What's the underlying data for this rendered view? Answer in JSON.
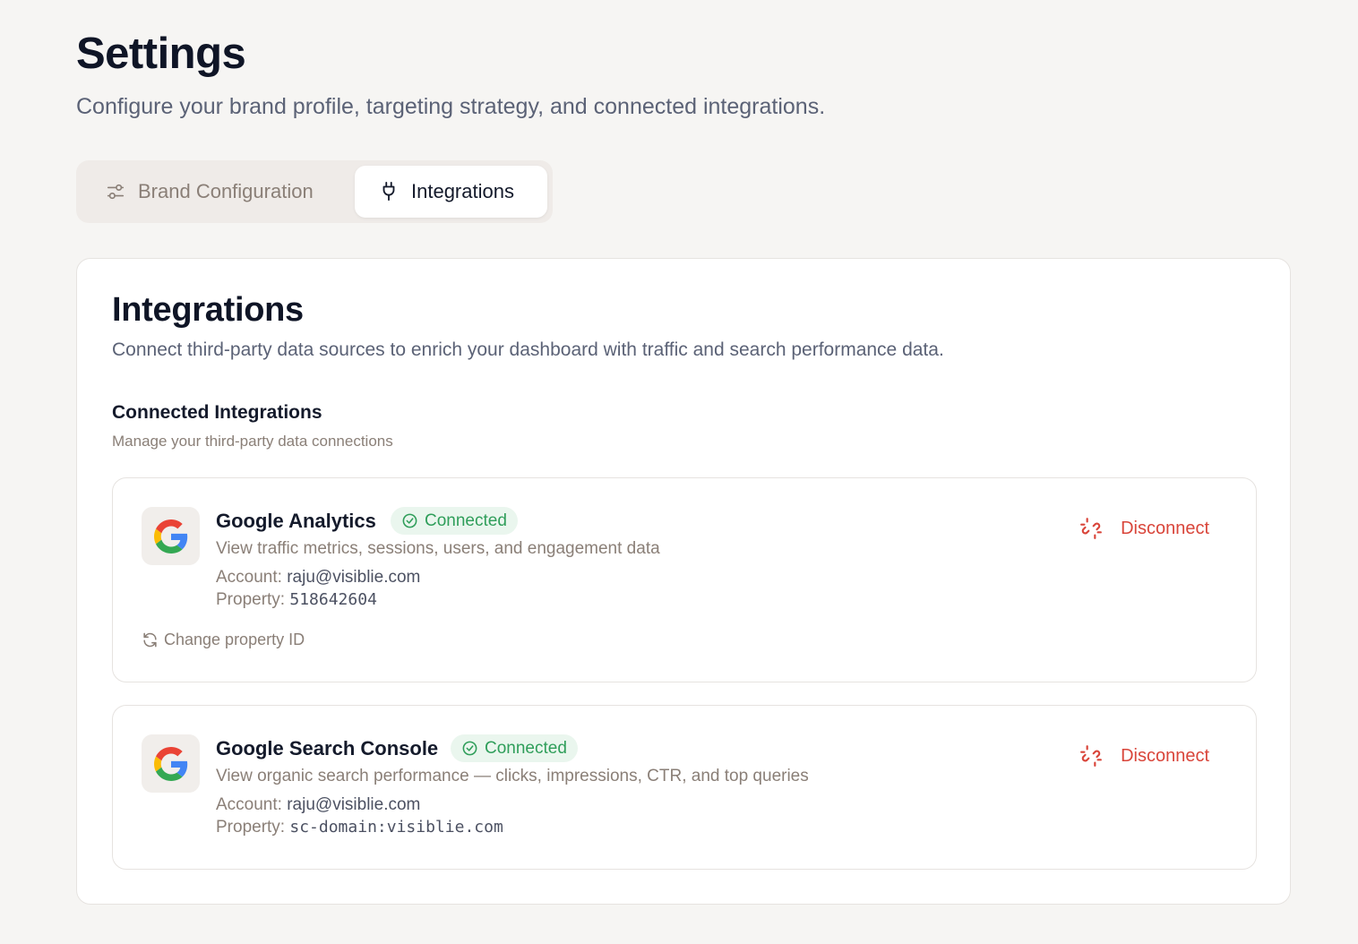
{
  "page": {
    "title": "Settings",
    "subtitle": "Configure your brand profile, targeting strategy, and connected integrations."
  },
  "tabs": [
    {
      "label": "Brand Configuration",
      "icon": "sliders-icon",
      "active": false
    },
    {
      "label": "Integrations",
      "icon": "plug-icon",
      "active": true
    }
  ],
  "integrations_panel": {
    "title": "Integrations",
    "description": "Connect third-party data sources to enrich your dashboard with traffic and search performance data.",
    "section_title": "Connected Integrations",
    "section_description": "Manage your third-party data connections",
    "items": [
      {
        "name": "Google Analytics",
        "status": "Connected",
        "description": "View traffic metrics, sessions, users, and engagement data",
        "account_label": "Account:",
        "account_value": "raju@visiblie.com",
        "property_label": "Property:",
        "property_value": "518642604",
        "disconnect_label": "Disconnect",
        "change_label": "Change property ID"
      },
      {
        "name": "Google Search Console",
        "status": "Connected",
        "description": "View organic search performance — clicks, impressions, CTR, and top queries",
        "account_label": "Account:",
        "account_value": "raju@visiblie.com",
        "property_label": "Property:",
        "property_value": "sc-domain:visiblie.com",
        "disconnect_label": "Disconnect"
      }
    ]
  },
  "colors": {
    "background": "#f6f5f3",
    "success": "#2f9e5a",
    "danger": "#d9453a",
    "muted": "#8a7f77"
  }
}
